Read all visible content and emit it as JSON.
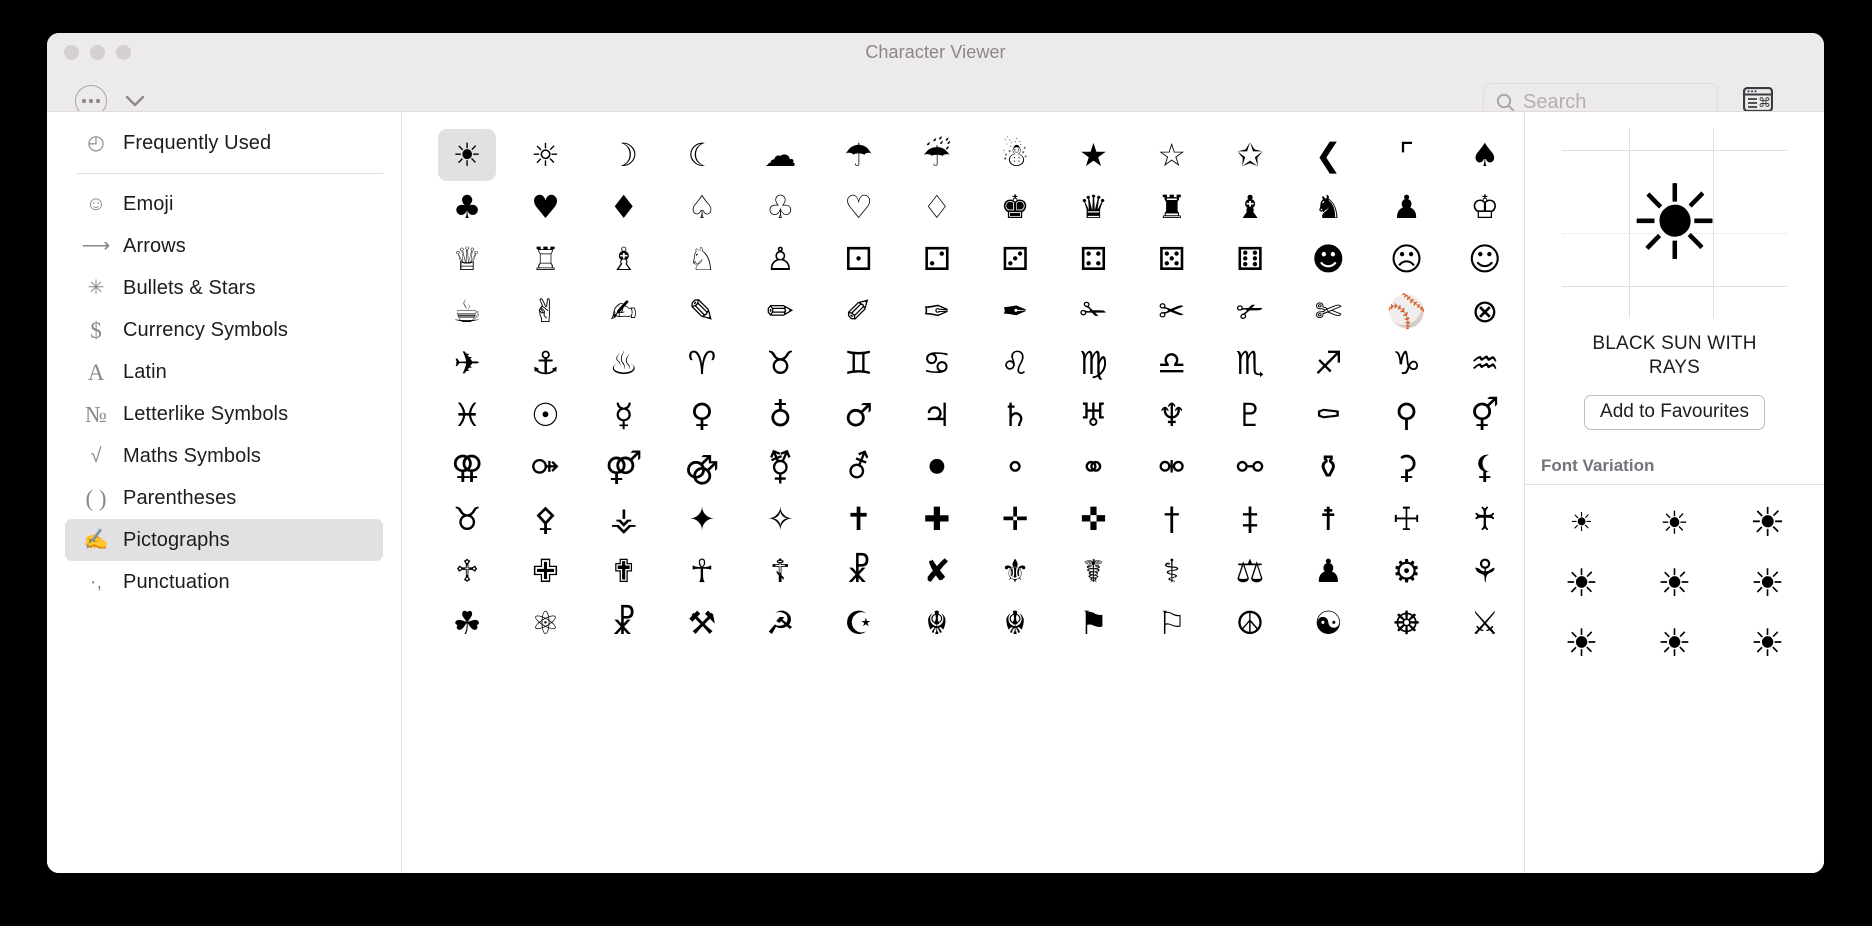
{
  "window": {
    "title": "Character Viewer",
    "traffic_lights": [
      "close",
      "minimise",
      "zoom"
    ]
  },
  "toolbar": {
    "options_icon": "ellipsis-circle-icon",
    "chevron_icon": "chevron-down-icon",
    "search": {
      "icon": "search-icon",
      "placeholder": "Search",
      "value": ""
    },
    "keyboard_toggle_icon": "character-palette-icon"
  },
  "sidebar": {
    "items": [
      {
        "label": "Frequently Used",
        "icon": "clock-icon",
        "glyph": "◴",
        "selected": false,
        "separator_after": true
      },
      {
        "label": "Emoji",
        "icon": "smiley-icon",
        "glyph": "☺",
        "selected": false
      },
      {
        "label": "Arrows",
        "icon": "arrow-right-icon",
        "glyph": "⟶",
        "selected": false
      },
      {
        "label": "Bullets & Stars",
        "icon": "asterisk-icon",
        "glyph": "✳",
        "selected": false
      },
      {
        "label": "Currency Symbols",
        "icon": "dollar-icon",
        "glyph": "$",
        "selected": false
      },
      {
        "label": "Latin",
        "icon": "letter-a-icon",
        "glyph": "A",
        "selected": false
      },
      {
        "label": "Letterlike Symbols",
        "icon": "numero-icon",
        "glyph": "№",
        "selected": false
      },
      {
        "label": "Maths Symbols",
        "icon": "square-root-icon",
        "glyph": "√",
        "selected": false
      },
      {
        "label": "Parentheses",
        "icon": "parentheses-icon",
        "glyph": "( )",
        "selected": false
      },
      {
        "label": "Pictographs",
        "icon": "writing-hand-icon",
        "glyph": "✍",
        "selected": true
      },
      {
        "label": "Punctuation",
        "icon": "comma-icon",
        "glyph": "·,",
        "selected": false
      }
    ]
  },
  "grid": {
    "columns": 14,
    "selected_index": 0,
    "characters": [
      "☀",
      "☼",
      "☽",
      "☾",
      "☁",
      "☂",
      "☔",
      "☃",
      "★",
      "☆",
      "✩",
      "❮",
      "⌜",
      "♠",
      "♣",
      "♥",
      "♦",
      "♤",
      "♧",
      "♡",
      "♢",
      "♚",
      "♛",
      "♜",
      "♝",
      "♞",
      "♟",
      "♔",
      "♕",
      "♖",
      "♗",
      "♘",
      "♙",
      "⚀",
      "⚁",
      "⚂",
      "⚃",
      "⚄",
      "⚅",
      "☻",
      "☹",
      "☺",
      "☕",
      "✌",
      "✍",
      "✎",
      "✏",
      "✐",
      "✑",
      "✒",
      "✁",
      "✂",
      "✃",
      "✄",
      "⚾",
      "⊗",
      "✈",
      "⚓",
      "♨",
      "♈",
      "♉",
      "♊",
      "♋",
      "♌",
      "♍",
      "♎",
      "♏",
      "♐",
      "♑",
      "♒",
      "♓",
      "☉",
      "☿",
      "♀",
      "♁",
      "♂",
      "♃",
      "♄",
      "♅",
      "♆",
      "♇",
      "⚰",
      "⚲",
      "⚥",
      "⚢",
      "⚩",
      "⚤",
      "⚣",
      "⚧",
      "⚦",
      "⚫",
      "⚬",
      "⚭",
      "⚮",
      "⚯",
      "⚱",
      "⚳",
      "⚸",
      "♉",
      "⚴",
      "⚶",
      "✦",
      "✧",
      "✝",
      "✚",
      "✛",
      "✜",
      "†",
      "‡",
      "☨",
      "☩",
      "♰",
      "♱",
      "✙",
      "✟",
      "☥",
      "☦",
      "☧",
      "✘",
      "⚜",
      "☤",
      "⚕",
      "⚖",
      "♟",
      "⚙",
      "⚘",
      "☘",
      "⚛",
      "☧",
      "⚒",
      "☭",
      "☪",
      "☬",
      "☬",
      "⚑",
      "⚐",
      "☮",
      "☯",
      "☸",
      "⚔"
    ]
  },
  "detail": {
    "glyph": "☀",
    "name": "BLACK SUN WITH RAYS",
    "favourite_button": "Add to Favourites",
    "variation_header": "Font Variation",
    "variations": [
      "☀",
      "☀",
      "☀",
      "☀",
      "☀",
      "☀",
      "☀",
      "☀",
      "☀"
    ],
    "variation_sizes": [
      "26px",
      "32px",
      "40px",
      "38px",
      "38px",
      "38px",
      "38px",
      "38px",
      "38px"
    ]
  }
}
